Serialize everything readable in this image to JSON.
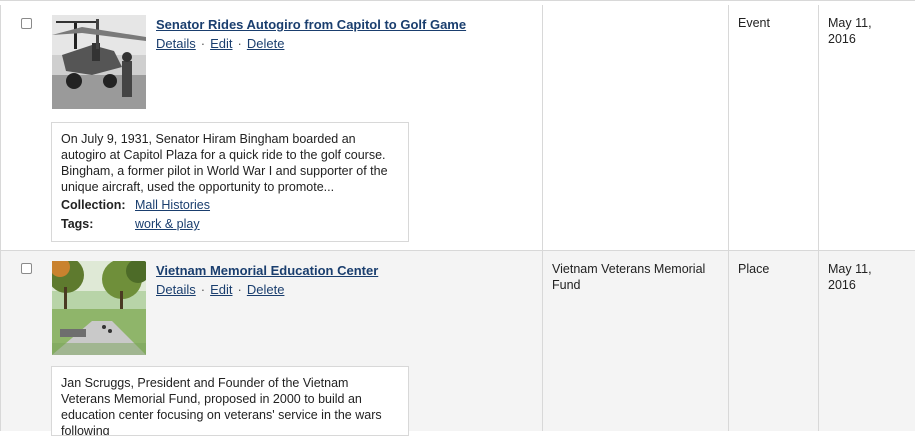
{
  "rows": [
    {
      "title": "Senator Rides Autogiro from Capitol to Golf Game",
      "actions": {
        "details": "Details",
        "edit": "Edit",
        "delete": "Delete",
        "sep": "·"
      },
      "description": "On July 9, 1931, Senator Hiram Bingham boarded an autogiro at Capitol Plaza for a quick ride to the golf course. Bingham, a former pilot in World War I and supporter of the unique aircraft, used the opportunity to promote...",
      "collection_label": "Collection:",
      "collection_value": "Mall Histories",
      "tags_label": "Tags:",
      "tags_value": "work & play",
      "creator": "",
      "type": "Event",
      "date": "May 11, 2016"
    },
    {
      "title": "Vietnam Memorial Education Center",
      "actions": {
        "details": "Details",
        "edit": "Edit",
        "delete": "Delete",
        "sep": "·"
      },
      "description": "Jan Scruggs, President and Founder of the Vietnam Veterans Memorial Fund, proposed in 2000 to build an education center focusing on veterans' service in the wars following",
      "creator": "Vietnam Veterans Memorial Fund",
      "type": "Place",
      "date": "May 11, 2016"
    }
  ],
  "colors": {
    "link": "#1a3e6e",
    "border": "#d8d8d8",
    "alt_row": "#f4f4f4"
  }
}
